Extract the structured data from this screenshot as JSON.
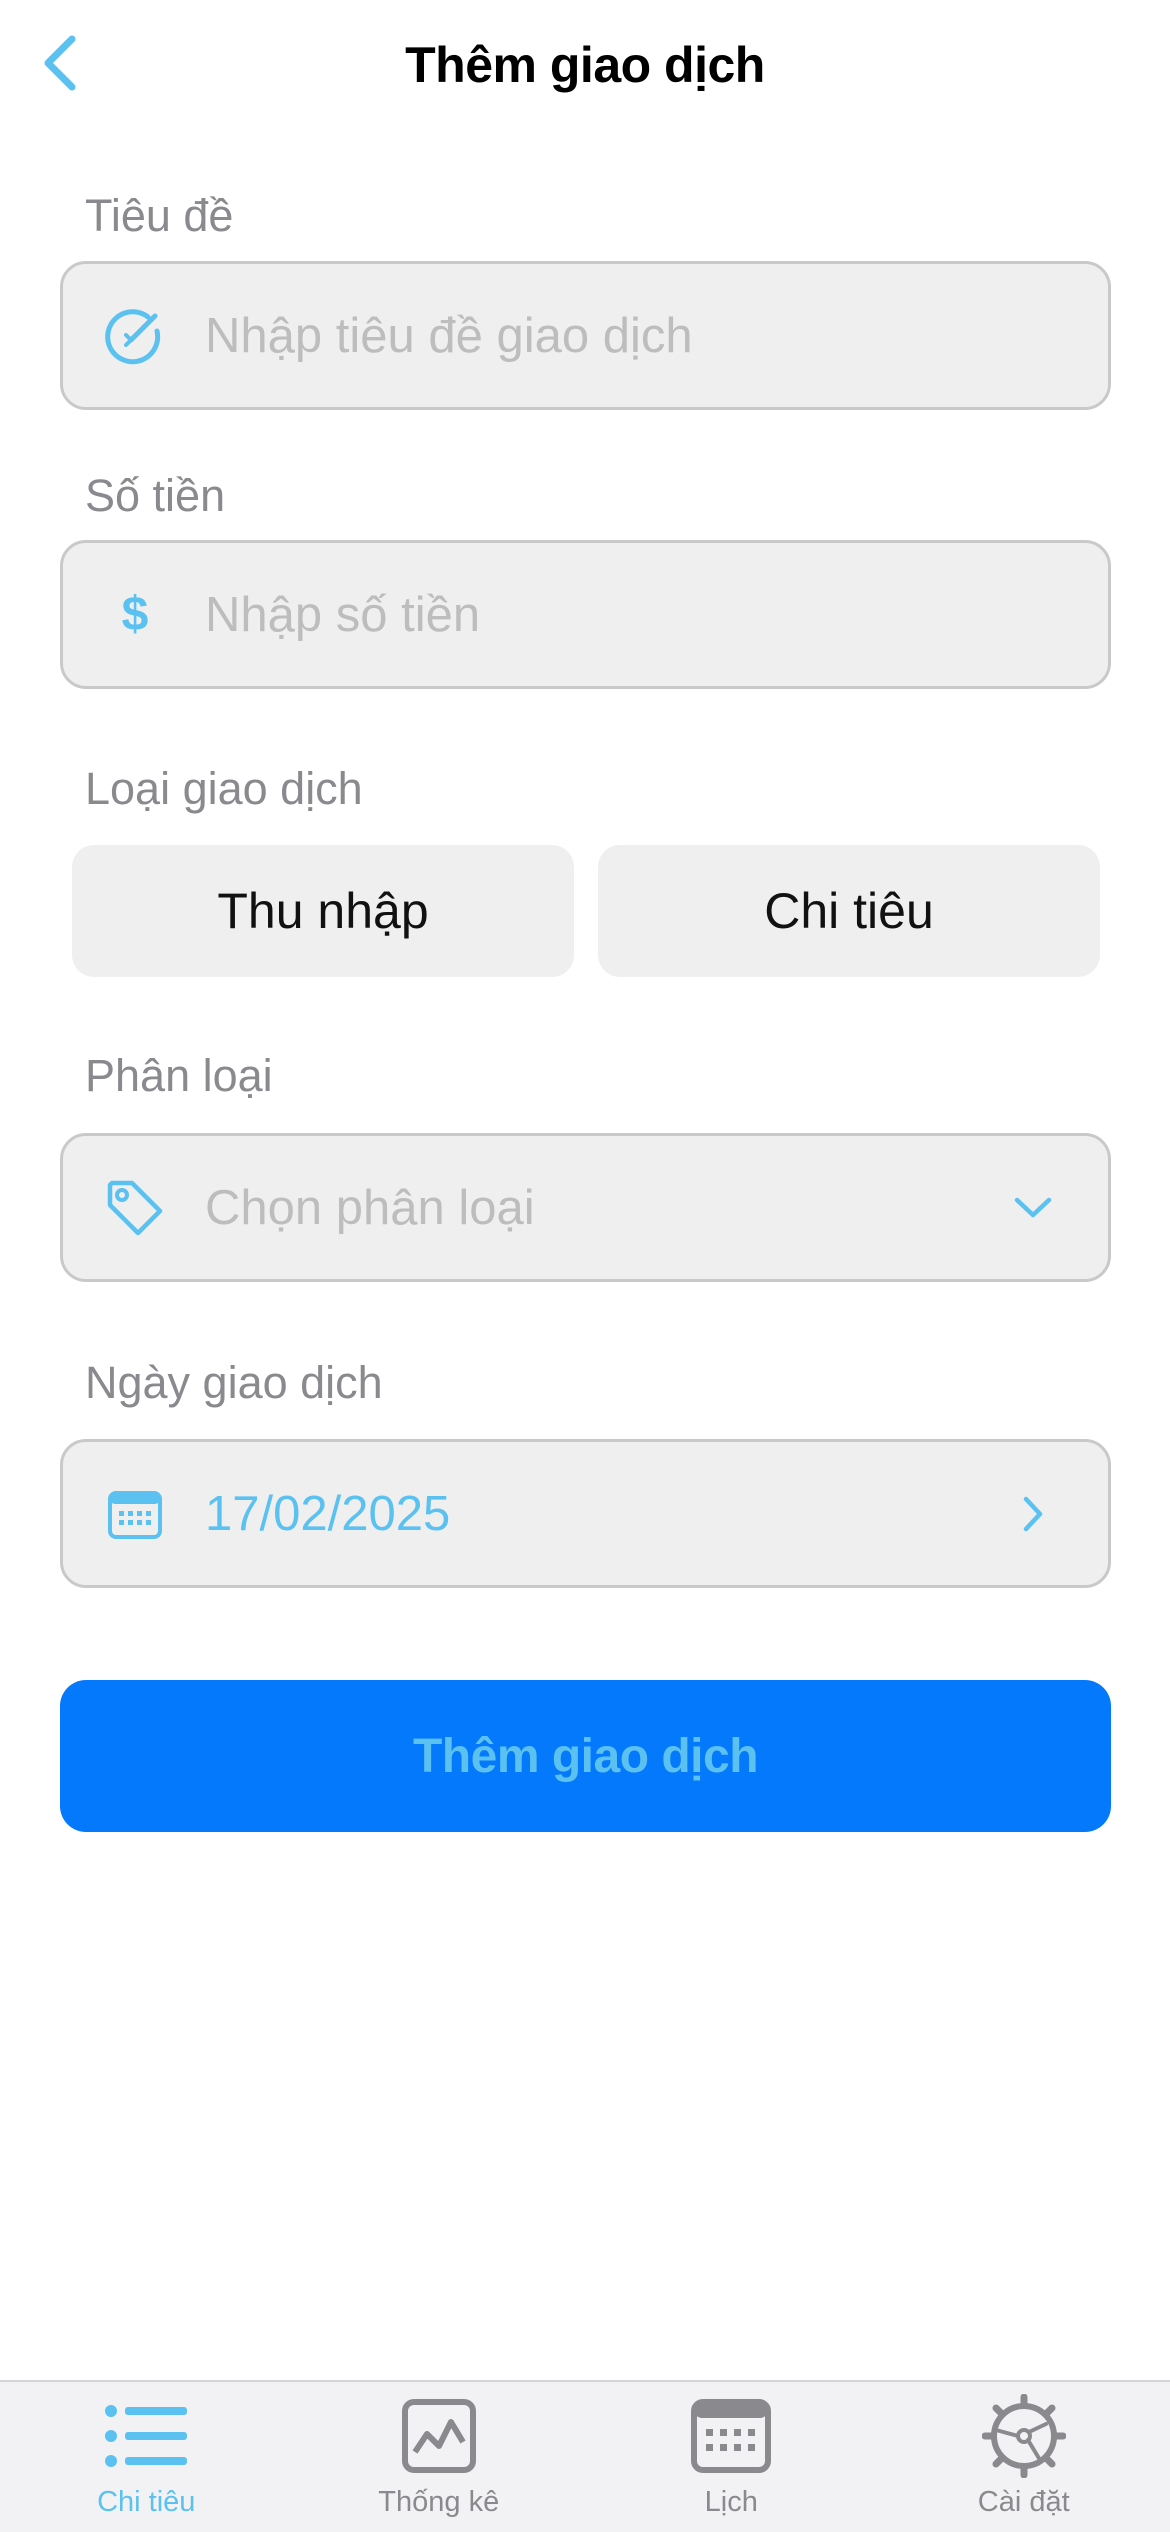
{
  "header": {
    "title": "Thêm giao dịch",
    "back_icon": "chevron-left-icon"
  },
  "form": {
    "title_field": {
      "label": "Tiêu đề",
      "placeholder": "Nhập tiêu đề giao dịch",
      "icon": "edit-pencil-circle-icon"
    },
    "amount_field": {
      "label": "Số tiền",
      "placeholder": "Nhập số tiền",
      "icon": "dollar-icon",
      "icon_glyph": "$"
    },
    "type_field": {
      "label": "Loại giao dịch",
      "options": [
        "Thu nhập",
        "Chi tiêu"
      ]
    },
    "category_field": {
      "label": "Phân loại",
      "placeholder": "Chọn phân loại",
      "icon": "tag-icon",
      "trailing_icon": "chevron-down-icon"
    },
    "date_field": {
      "label": "Ngày giao dịch",
      "value": "17/02/2025",
      "icon": "calendar-icon",
      "trailing_icon": "chevron-right-icon"
    },
    "submit_label": "Thêm giao dịch"
  },
  "tab_bar": {
    "active_index": 0,
    "items": [
      {
        "label": "Chi tiêu",
        "icon": "list-icon"
      },
      {
        "label": "Thống kê",
        "icon": "chart-icon"
      },
      {
        "label": "Lịch",
        "icon": "calendar-icon"
      },
      {
        "label": "Cài đặt",
        "icon": "gear-icon"
      }
    ]
  },
  "colors": {
    "accent": "#5ac1f0",
    "primary_button": "#0579fb",
    "input_bg": "#efefef",
    "input_border": "#c9c9c9",
    "label": "#8a8a8e",
    "placeholder": "#bdbdbd"
  }
}
